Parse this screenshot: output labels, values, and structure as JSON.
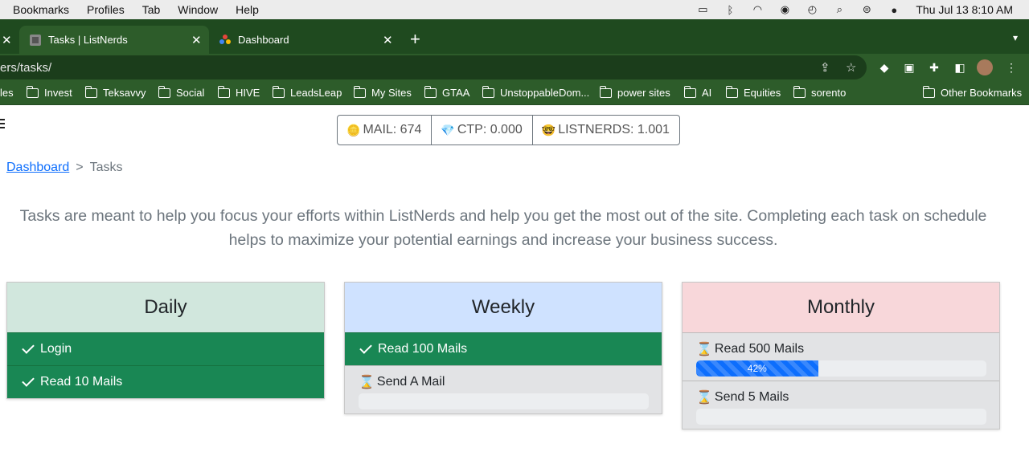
{
  "menubar": {
    "items": [
      "Bookmarks",
      "Profiles",
      "Tab",
      "Window",
      "Help"
    ],
    "clock": "Thu Jul 13  8:10 AM"
  },
  "tabs": [
    {
      "title": "Tasks | ListNerds",
      "active": true
    },
    {
      "title": "Dashboard",
      "active": false
    }
  ],
  "address": {
    "url": "ers/tasks/"
  },
  "bookmarks": [
    "les",
    "Invest",
    "Teksavvy",
    "Social",
    "HIVE",
    "LeadsLeap",
    "My Sites",
    "GTAA",
    "UnstoppableDom...",
    "power sites",
    "AI",
    "Equities",
    "sorento",
    "Other Bookmarks"
  ],
  "stats": {
    "mail": "MAIL: 674",
    "ctp": "CTP: 0.000",
    "listnerds": "LISTNERDS: 1.001"
  },
  "breadcrumb": {
    "link": "Dashboard",
    "sep": ">",
    "current": "Tasks"
  },
  "intro": "Tasks are meant to help you focus your efforts within ListNerds and help you get the most out of the site. Completing each task on schedule helps to maximize your potential earnings and increase your business success.",
  "cards": {
    "daily": {
      "title": "Daily",
      "header_color": "#d1e7dd",
      "tasks": [
        "Login",
        "Read 10 Mails"
      ]
    },
    "weekly": {
      "title": "Weekly",
      "header_color": "#cfe2ff",
      "done_task": "Read 100 Mails",
      "pending_task": "Send A Mail",
      "pending_progress": 0
    },
    "monthly": {
      "title": "Monthly",
      "header_color": "#f8d7da",
      "task1": "Read 500 Mails",
      "task1_progress": 0.42,
      "task1_progress_label": "42%",
      "task2": "Send 5 Mails",
      "task2_progress": 0
    }
  },
  "colors": {
    "done": "#198754",
    "progress": "#0d6efd",
    "browser_frame": "#1f4a1f"
  }
}
